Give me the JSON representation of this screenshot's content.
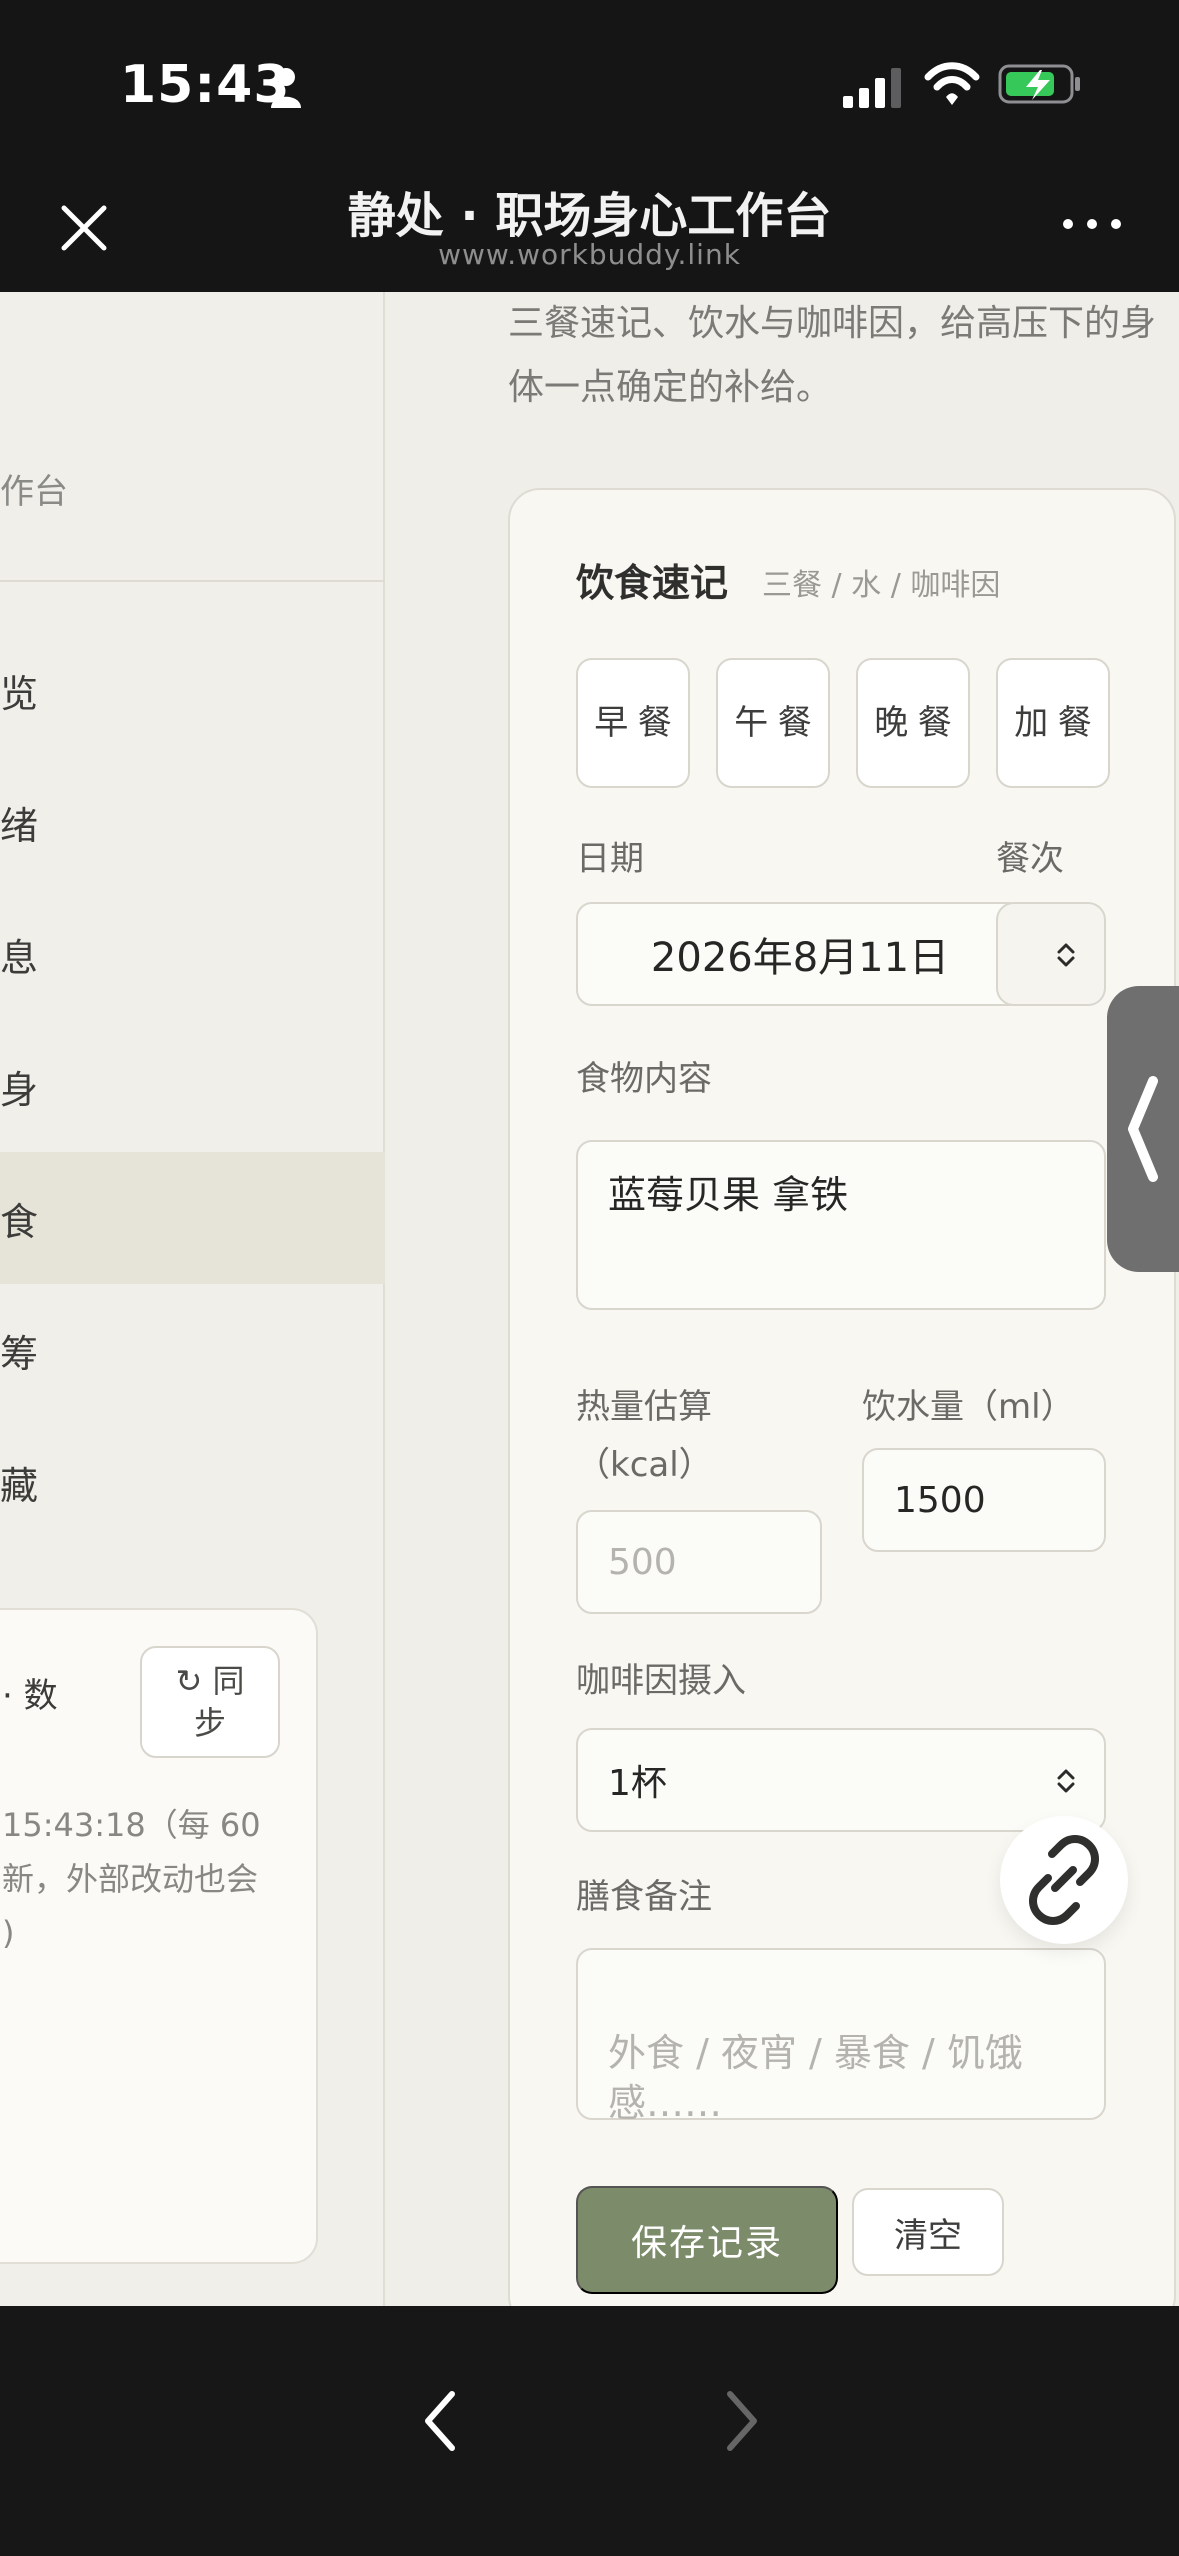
{
  "status_bar": {
    "time": "15:43"
  },
  "browser": {
    "title": "静处 · 职场身心工作台",
    "url": "www.workbuddy.link"
  },
  "sidebar": {
    "brand": "作台",
    "items": [
      {
        "label": "览",
        "active": false
      },
      {
        "label": "绪",
        "active": false
      },
      {
        "label": "息",
        "active": false
      },
      {
        "label": "身",
        "active": false
      },
      {
        "label": "食",
        "active": true
      },
      {
        "label": "筹",
        "active": false
      },
      {
        "label": "藏",
        "active": false
      }
    ],
    "sync_card": {
      "title": "· 数",
      "button": "↻ 同\n步",
      "text": "15:43:18（每 60\n新，外部改动也会\n)"
    }
  },
  "main": {
    "intro": "三餐速记、饮水与咖啡因，给高压下的身体一点确定的补给。",
    "card": {
      "title": "饮食速记",
      "subtitle": "三餐 / 水 / 咖啡因",
      "meal_buttons": [
        "早\n餐",
        "午\n餐",
        "晚\n餐",
        "加\n餐"
      ],
      "date_label": "日期",
      "meal_type_label": "餐次",
      "date_value": "2026年8月11日",
      "food_label": "食物内容",
      "food_value": "蓝莓贝果 拿铁",
      "calories_label": "热量估算\n（kcal）",
      "calories_placeholder": "500",
      "water_label": "饮水量（ml）",
      "water_value": "1500",
      "caffeine_label": "咖啡因摄入",
      "caffeine_value": "1杯",
      "notes_label": "膳食备注",
      "notes_placeholder": "外食 / 夜宵 / 暴食 / 饥饿\n感……",
      "save_button": "保存记录",
      "clear_button": "清空"
    }
  },
  "colors": {
    "primary": "#7c8b69",
    "background": "#f0eee8",
    "sidebar_active": "#e6e3d8"
  }
}
